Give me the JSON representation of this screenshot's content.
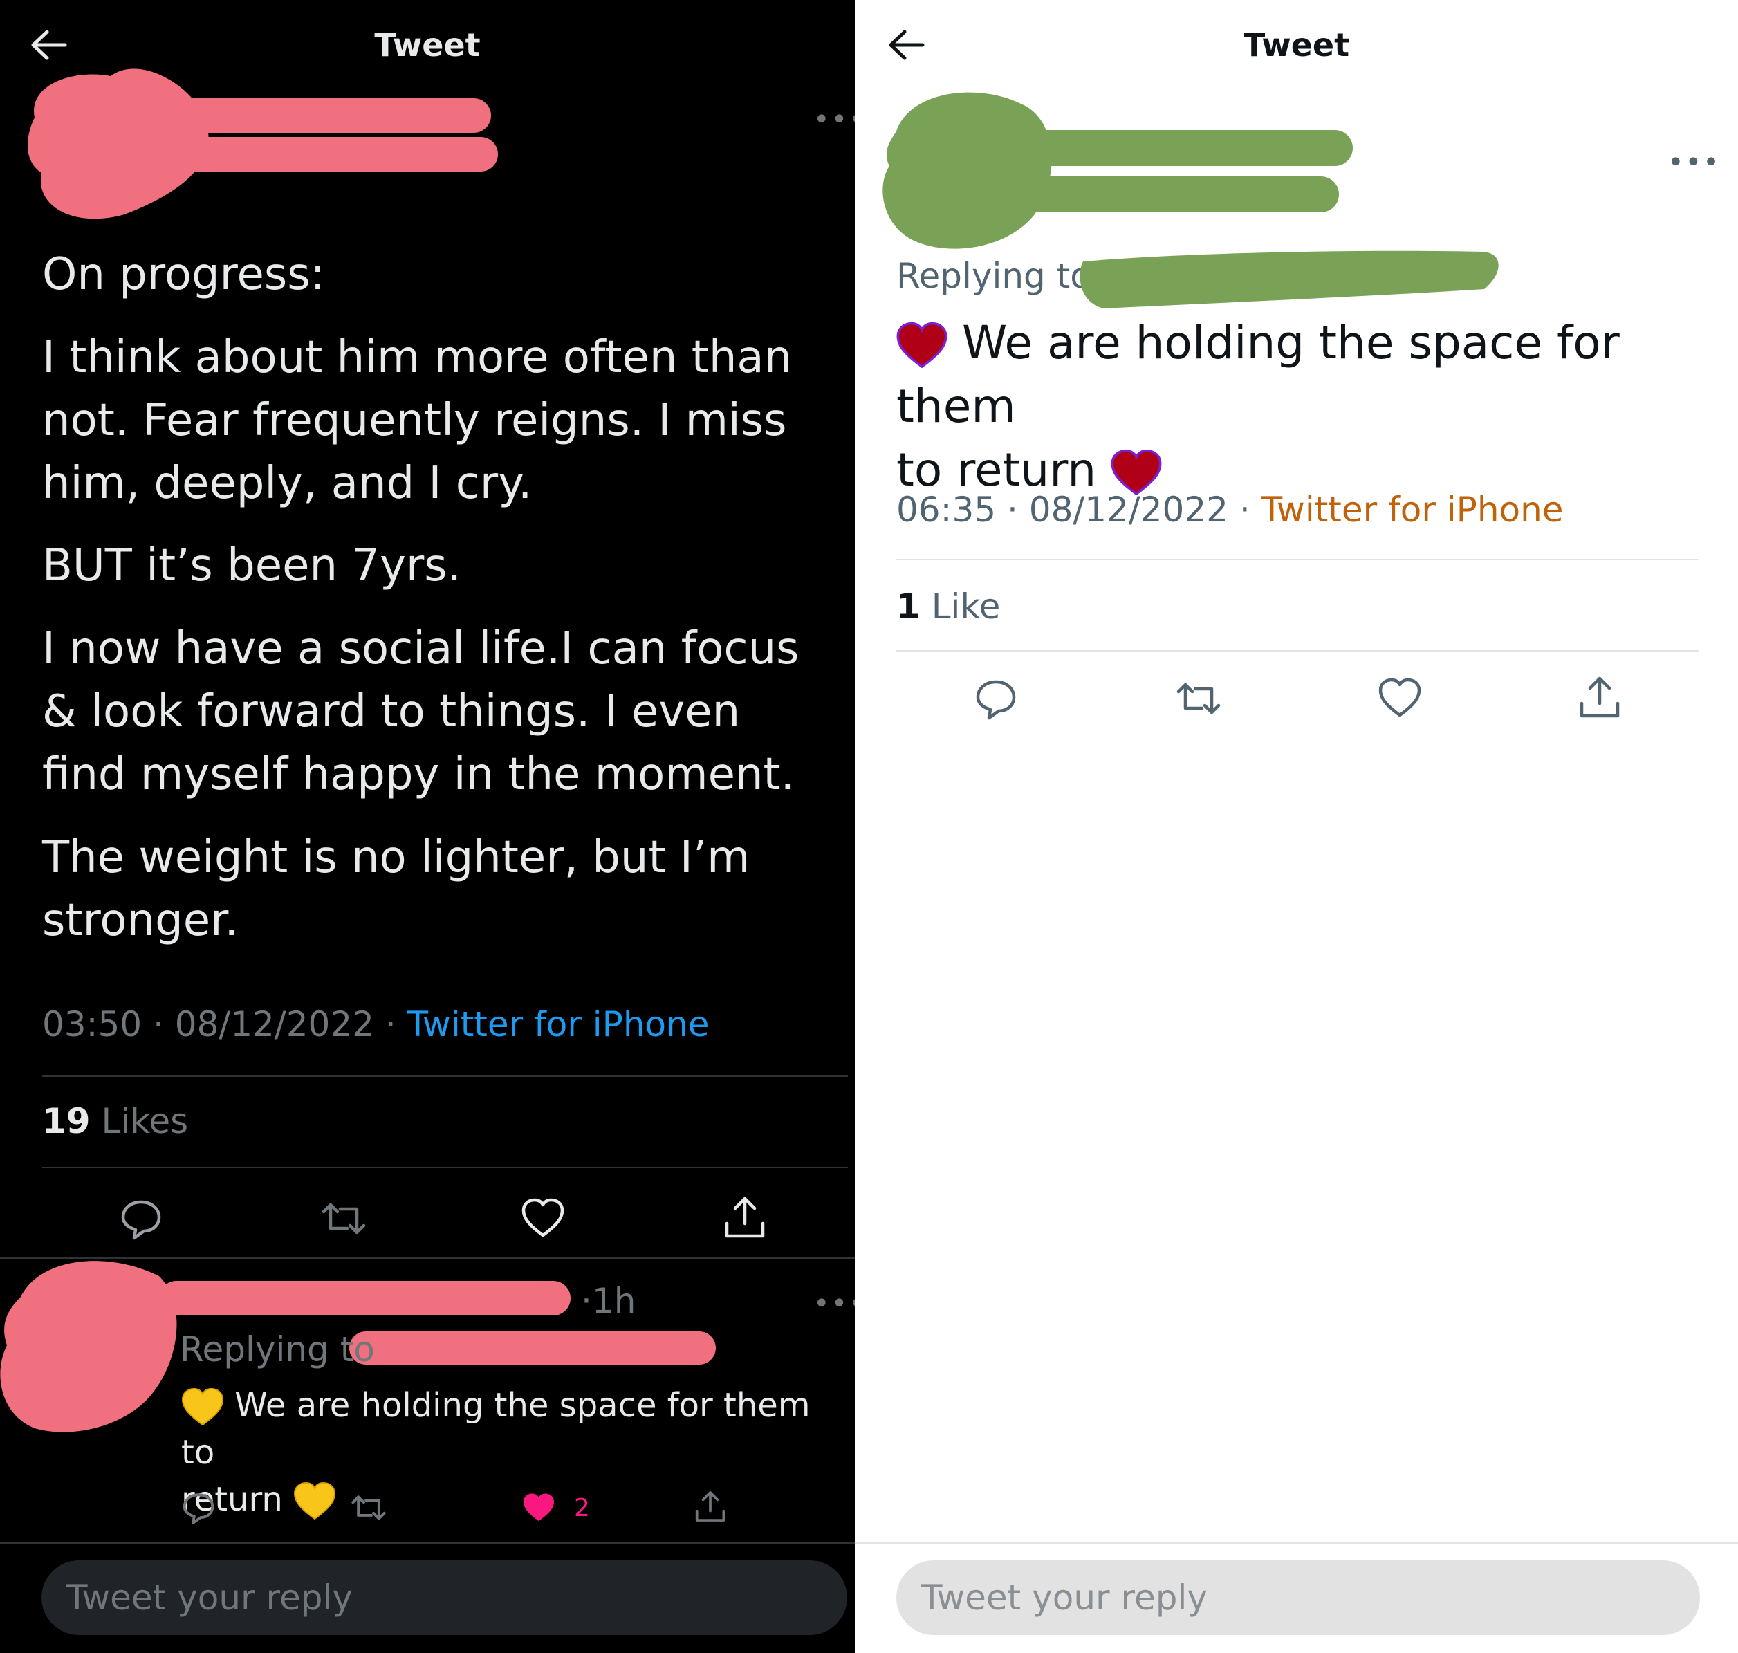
{
  "left": {
    "header": {
      "title": "Tweet"
    },
    "tweet": {
      "paragraphs": [
        "On progress:",
        "I think about him more often than not. Fear frequently reigns. I miss him, deeply, and I cry.",
        "BUT it’s been 7yrs.",
        "I now have a social life.I can focus & look forward to things. I even find myself happy in the moment.",
        "The weight is no lighter, but I’m stronger."
      ],
      "time": "03:50",
      "date": "08/12/2022",
      "source": "Twitter for iPhone",
      "likes_count": "19",
      "likes_label": "Likes"
    },
    "reply": {
      "age": "1h",
      "replying_to_label": "Replying to",
      "text_start": "We are holding the space for them to",
      "text_end": "return",
      "emoji": "yellow-heart",
      "like_count": "2"
    },
    "compose": {
      "placeholder": "Tweet your reply"
    },
    "colors": {
      "background": "#000000",
      "link": "#1d9bf0",
      "like": "#f91880",
      "redaction": "#f07080"
    }
  },
  "right": {
    "header": {
      "title": "Tweet"
    },
    "tweet": {
      "replying_to_label": "Replying to",
      "text_line1": "We are holding the space for them",
      "text_line2": "to return",
      "emoji": "red-heart",
      "time": "06:35",
      "date": "08/12/2022",
      "source": "Twitter for iPhone",
      "likes_count": "1",
      "likes_label": "Like"
    },
    "compose": {
      "placeholder": "Tweet your reply"
    },
    "colors": {
      "background": "#ffffff",
      "link": "#c0620a",
      "redaction": "#79a257"
    }
  }
}
